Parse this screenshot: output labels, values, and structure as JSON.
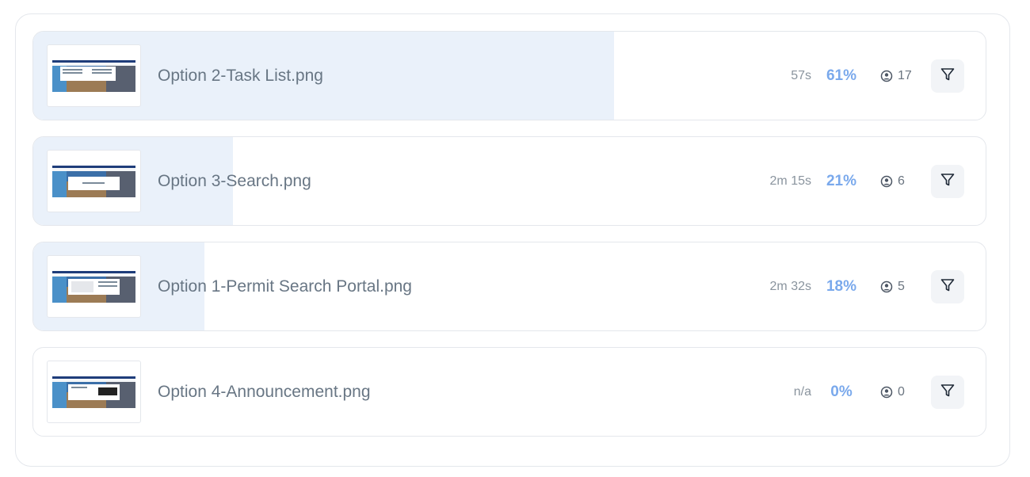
{
  "results": [
    {
      "name": "Option 2-Task List.png",
      "time": "57s",
      "percent": "61%",
      "percent_value": 0.61,
      "users": "17",
      "thumbnail_icon": "screenshot-thumbnail-icon",
      "filter_icon": "filter-icon"
    },
    {
      "name": "Option 3-Search.png",
      "time": "2m 15s",
      "percent": "21%",
      "percent_value": 0.21,
      "users": "6",
      "thumbnail_icon": "screenshot-thumbnail-icon",
      "filter_icon": "filter-icon"
    },
    {
      "name": "Option 1-Permit Search Portal.png",
      "time": "2m 32s",
      "percent": "18%",
      "percent_value": 0.18,
      "users": "5",
      "thumbnail_icon": "screenshot-thumbnail-icon",
      "filter_icon": "filter-icon"
    },
    {
      "name": "Option 4-Announcement.png",
      "time": "n/a",
      "percent": "0%",
      "percent_value": 0,
      "users": "0",
      "thumbnail_icon": "screenshot-thumbnail-icon",
      "filter_icon": "filter-icon"
    }
  ],
  "colors": {
    "progress_fill": "#eaf1fa",
    "percent_text": "#7aa9ec",
    "name_text": "#687684",
    "border": "#e4e7ec"
  }
}
